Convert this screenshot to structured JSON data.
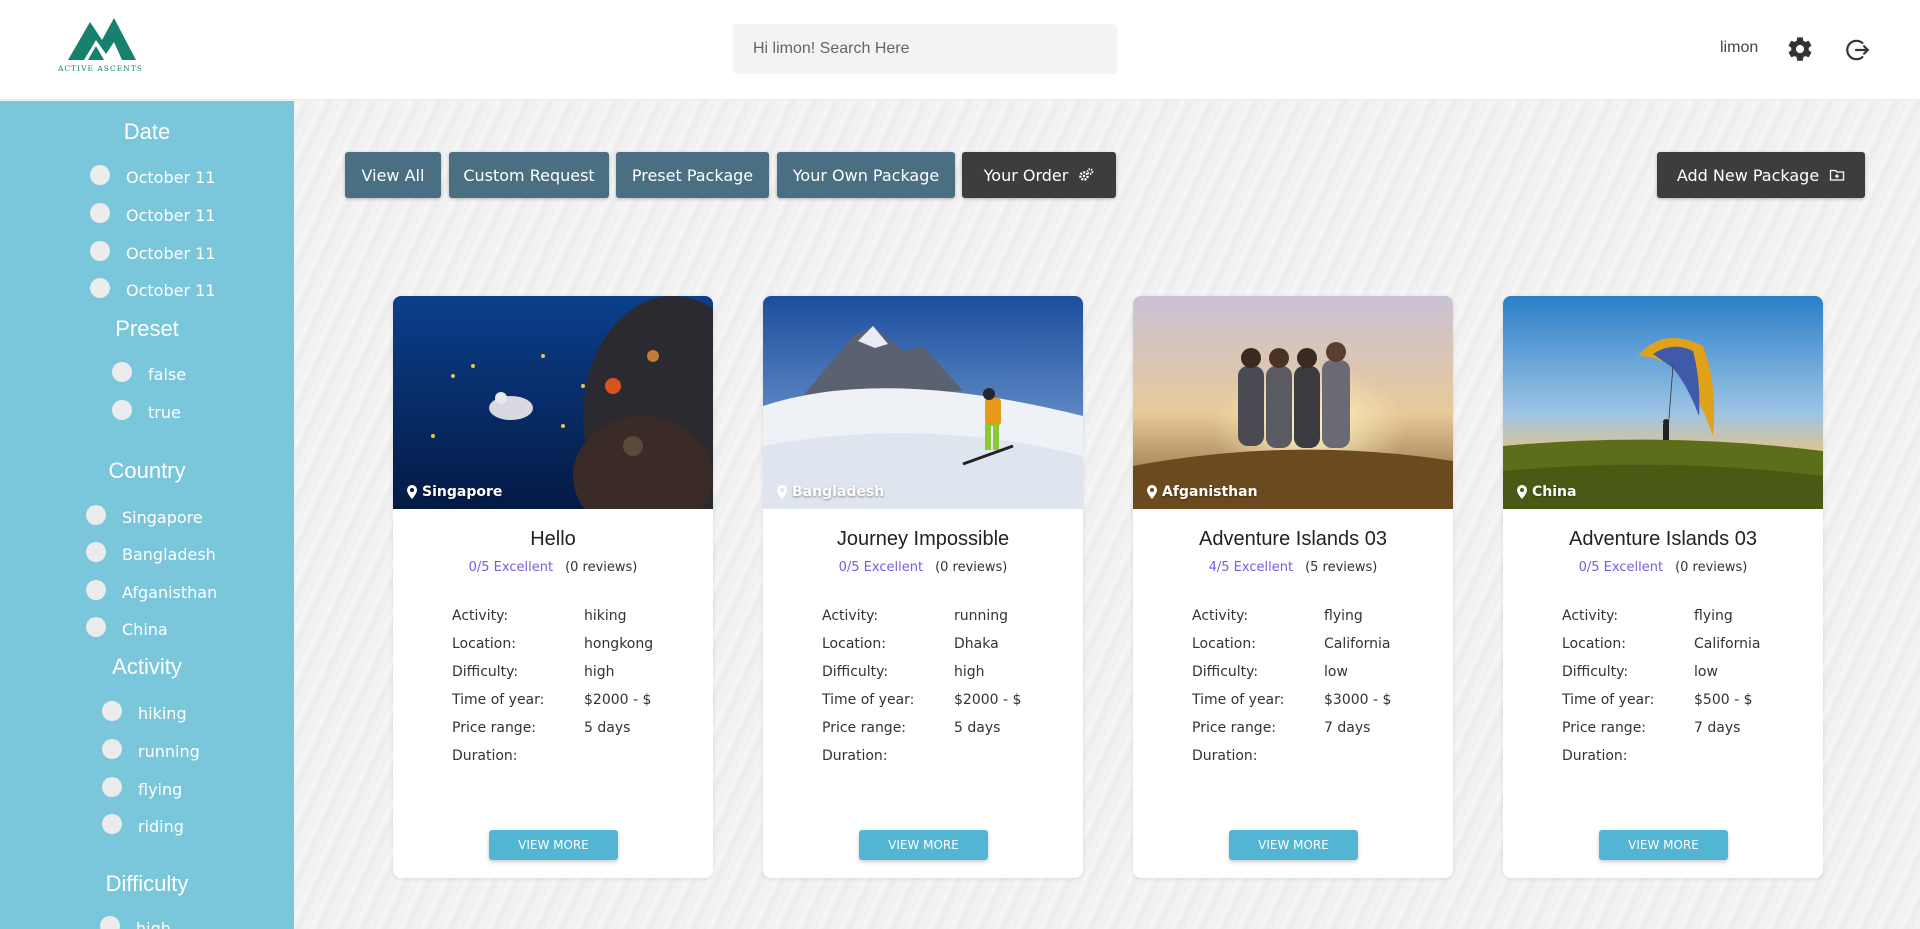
{
  "header": {
    "logo_text": "ACTIVE ASCENTS",
    "search_placeholder": "Hi limon! Search Here",
    "username": "limon",
    "settings_icon": "gear-icon",
    "logout_icon": "logout-icon"
  },
  "sidebar": {
    "date": {
      "title": "Date",
      "options": [
        "October 11",
        "October 11",
        "October 11",
        "October 11"
      ]
    },
    "preset": {
      "title": "Preset",
      "options": [
        "false",
        "true"
      ]
    },
    "country": {
      "title": "Country",
      "options": [
        "Singapore",
        "Bangladesh",
        "Afganisthan",
        "China"
      ]
    },
    "activity": {
      "title": "Activity",
      "options": [
        "hiking",
        "running",
        "flying",
        "riding"
      ]
    },
    "difficulty": {
      "title": "Difficulty",
      "options": [
        "high"
      ]
    }
  },
  "toolbar": {
    "view_all": "View All",
    "custom_request": "Custom Request",
    "preset_package": "Preset Package",
    "your_own_package": "Your Own Package",
    "your_order": "Your Order",
    "add_new_package": "Add New Package"
  },
  "labels": {
    "activity": "Activity:",
    "location": "Location:",
    "difficulty": "Difficulty:",
    "time_of_year": "Time of year:",
    "price_range": "Price range:",
    "duration": "Duration:",
    "view_more": "VIEW MORE"
  },
  "cards": [
    {
      "country": "Singapore",
      "title": "Hello",
      "rating": "0/5 Excellent",
      "reviews": "(0 reviews)",
      "values": [
        "hiking",
        "hongkong",
        "high",
        "$2000 - $",
        "5 days"
      ]
    },
    {
      "country": "Bangladesh",
      "title": "Journey Impossible",
      "rating": "0/5 Excellent",
      "reviews": "(0 reviews)",
      "values": [
        "running",
        "Dhaka",
        "high",
        "$2000 - $",
        "5 days"
      ]
    },
    {
      "country": "Afganisthan",
      "title": "Adventure Islands 03",
      "rating": "4/5 Excellent",
      "reviews": "(5 reviews)",
      "values": [
        "flying",
        "California",
        "low",
        "$3000 - $",
        "7 days"
      ]
    },
    {
      "country": "China",
      "title": "Adventure Islands 03",
      "rating": "0/5 Excellent",
      "reviews": "(0 reviews)",
      "values": [
        "flying",
        "California",
        "low",
        "$500 - $",
        "7 days"
      ]
    }
  ],
  "colors": {
    "sidebar": "#7ac6da",
    "tab_button": "#4a6e82",
    "dark_button": "#3d3d3d",
    "rating": "#7b5be0",
    "view_more": "#52b5d4"
  }
}
